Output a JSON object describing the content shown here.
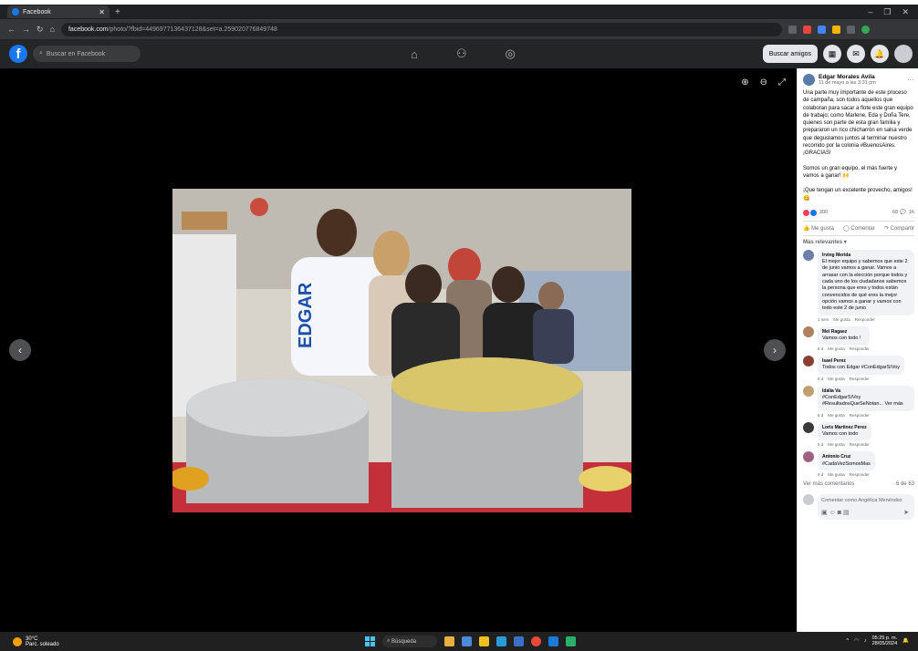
{
  "browser": {
    "tab_title": "Facebook",
    "url_domain": "facebook.com",
    "url_path": "/photo/?fbid=4496977136437128&set=a.259020776849748"
  },
  "fb": {
    "search_placeholder": "Buscar en Facebook",
    "find_friends": "Buscar amigos"
  },
  "post": {
    "author": "Edgar Morales Avila",
    "date": "11 de mayo a las 3:31 pm",
    "paragraph1": "Una parte muy importante de este proceso de campaña, son todos aquellos que colaboran para sacar a flote este gran equipo de trabajo; como Marlene, Eda y Doña Tere, quienes son parte de esta gran familia y prepararon un rico chicharrón en salsa verde que degustamos juntos al terminar nuestro recorrido por la colonia #BuenosAires. ¡GRACIAS!",
    "paragraph2": "Somos un gran equipo, el más fuerte y vamos a ganar! 🙌",
    "paragraph3": "¡Que tengan un excelente provecho, amigos! 😋",
    "reactions_count": "300",
    "comments_count": "68",
    "shares_count": "16",
    "like": "Me gusta",
    "comment": "Comentar",
    "share": "Compartir",
    "sort": "Más relevantes ▾"
  },
  "comments": [
    {
      "name": "Irving Merida",
      "text": "El mejor equipo y sabemos que este 2 de junio vamos a ganar. Vamos a arrasar con la elección porque todos y cada uno de los ciudadanos sabemos la persona que eres y todos están convencidos de qué eres la mejor opción vamos a ganar y vamos con todo este 2 de junio",
      "time": "1 sem",
      "like": "Me gusta",
      "reply": "Responder",
      "color": "#6b7fa8"
    },
    {
      "name": "Mel Ragaez",
      "text": "Vamos con todo !",
      "time": "6 d",
      "like": "Me gusta",
      "reply": "Responder",
      "color": "#b08060"
    },
    {
      "name": "Isael Perez",
      "text": "Todos con Edgar #ConEdgarSíVoy",
      "time": "6 d",
      "like": "Me gusta",
      "reply": "Responder",
      "color": "#8a4030"
    },
    {
      "name": "Idalia Va",
      "text": "#ConEdgarSíVoy #ResultadosQueSeNotan... Ver más",
      "time": "6 d",
      "like": "Me gusta",
      "reply": "Responder",
      "color": "#c0a070"
    },
    {
      "name": "Loris Martinez Perez",
      "text": "Vamos con todo",
      "time": "6 d",
      "like": "Me gusta",
      "reply": "Responder",
      "color": "#3a3a3a"
    },
    {
      "name": "Antonio Cruz",
      "text": "#CadaVezSomosMas",
      "time": "6 d",
      "like": "Me gusta",
      "reply": "Responder",
      "color": "#a06080"
    }
  ],
  "more_comments": {
    "label": "Ver más comentarios",
    "count": "6 de 63"
  },
  "compose_placeholder": "Comentar como Angélica Menéndez",
  "taskbar": {
    "temp": "30°C",
    "weather": "Parc. soleado",
    "search": "Búsqueda",
    "time": "05:25 p. m.",
    "date": "28/05/2024"
  }
}
